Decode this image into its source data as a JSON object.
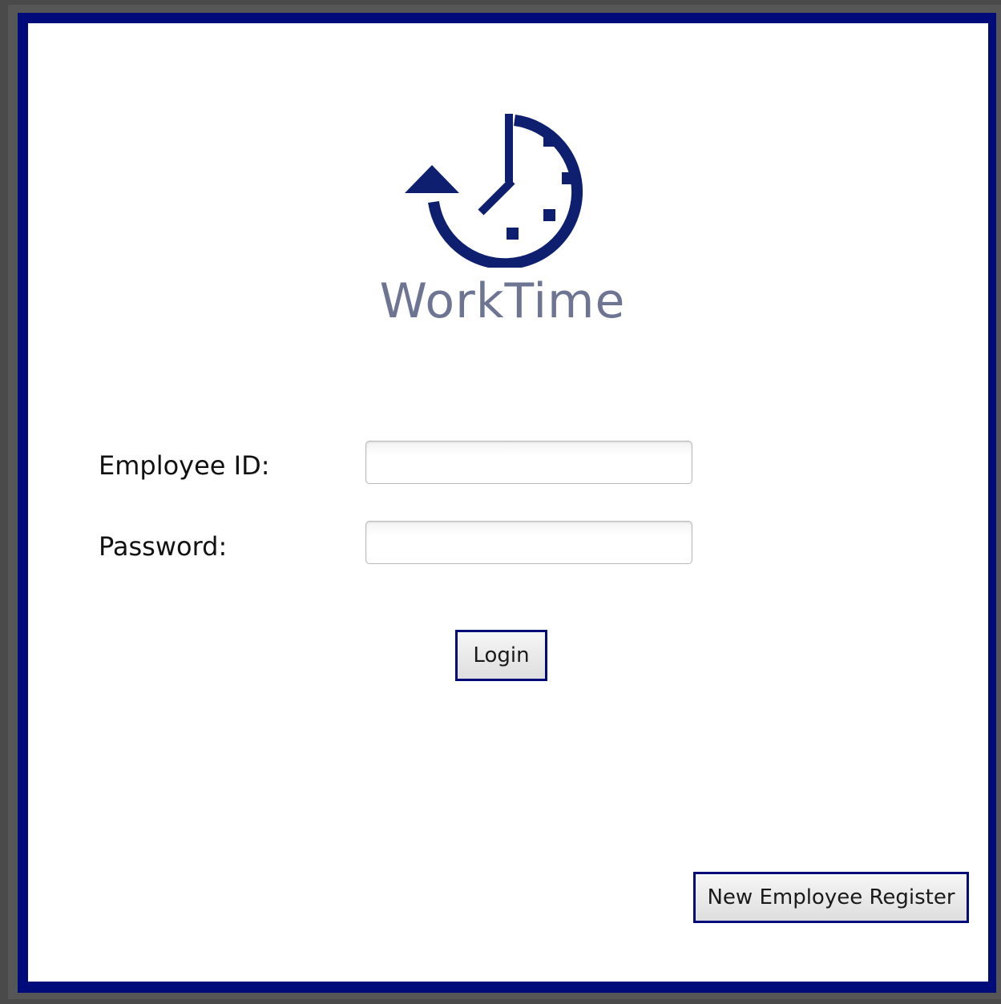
{
  "app": {
    "brand_name": "WorkTime",
    "logo_icon": "clock-history-icon",
    "colors": {
      "accent": "#000b7a",
      "brand_text": "#6d7593",
      "logo": "#0d1f6e"
    }
  },
  "login_form": {
    "employee_id_label": "Employee ID:",
    "employee_id_value": "",
    "password_label": "Password:",
    "password_value": "",
    "login_button": "Login"
  },
  "footer": {
    "register_button": "New Employee Register"
  }
}
